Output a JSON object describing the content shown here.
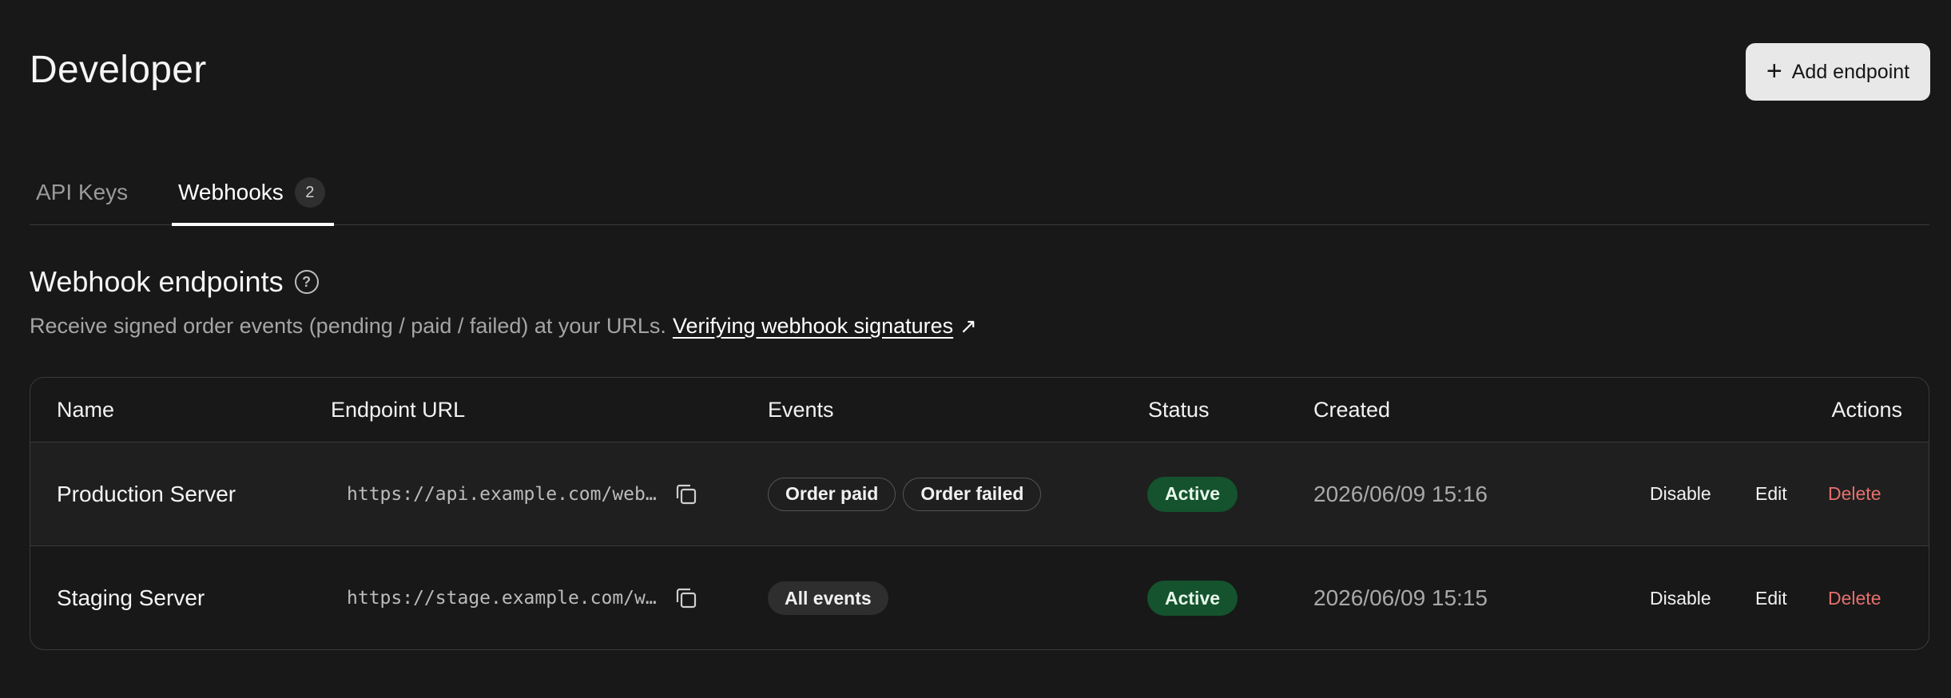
{
  "page": {
    "title": "Developer"
  },
  "header": {
    "add_button_label": "Add endpoint",
    "add_icon": "plus-icon"
  },
  "tabs": [
    {
      "label": "API Keys",
      "active": false
    },
    {
      "label": "Webhooks",
      "active": true,
      "count": "2"
    }
  ],
  "section": {
    "title": "Webhook endpoints",
    "help_icon": "question-circle-icon",
    "description": "Receive signed order events (pending / paid / failed) at your URLs.",
    "link_label": "Verifying webhook signatures",
    "link_icon": "external-arrow-icon"
  },
  "table": {
    "columns": [
      "Name",
      "Endpoint URL",
      "Events",
      "Status",
      "Created",
      "Actions"
    ],
    "rows": [
      {
        "name": "Production Server",
        "url": "https://api.example.com/webhooks",
        "events": [
          "Order paid",
          "Order failed"
        ],
        "status": "Active",
        "created": "2026/06/09 15:16",
        "actions": [
          "Disable",
          "Edit",
          "Delete"
        ]
      },
      {
        "name": "Staging Server",
        "url": "https://stage.example.com/webhooks",
        "events": [
          "All events"
        ],
        "status": "Active",
        "created": "2026/06/09 15:15",
        "actions": [
          "Disable",
          "Edit",
          "Delete"
        ]
      }
    ]
  },
  "colors": {
    "background": "#181818",
    "status_active_bg": "#14532d",
    "delete_text": "#e5706c"
  }
}
